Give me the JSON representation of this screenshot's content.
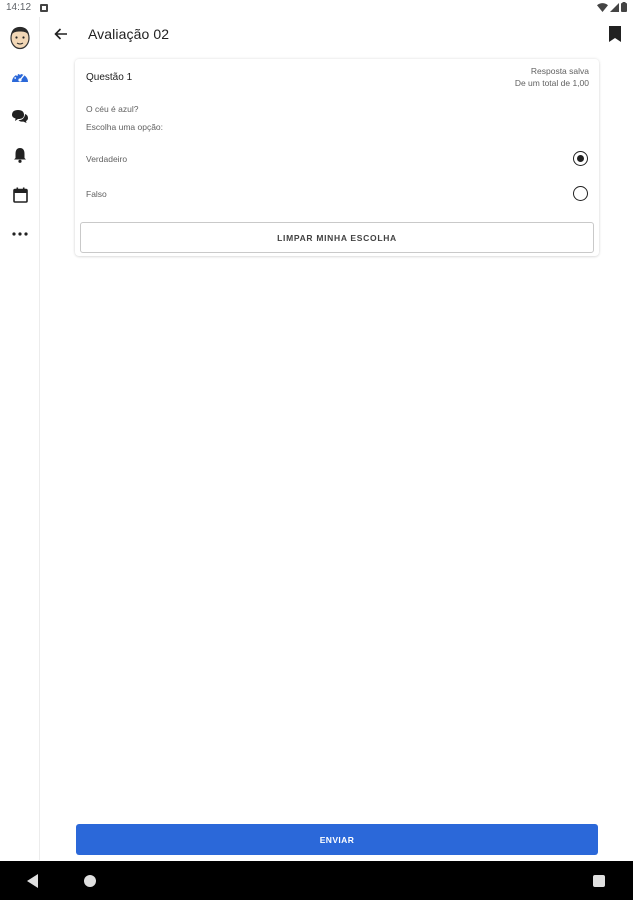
{
  "status_bar": {
    "time": "14:12",
    "icons": [
      "wifi-icon",
      "signal-icon",
      "battery-icon"
    ]
  },
  "sidebar": {
    "items": [
      {
        "name": "avatar",
        "icon": "avatar-icon"
      },
      {
        "name": "dashboard",
        "icon": "dashboard-icon",
        "color": "#2b68d9"
      },
      {
        "name": "messages",
        "icon": "chat-icon"
      },
      {
        "name": "notifications",
        "icon": "bell-icon"
      },
      {
        "name": "calendar",
        "icon": "calendar-icon"
      },
      {
        "name": "more",
        "icon": "more-icon"
      }
    ]
  },
  "header": {
    "title": "Avaliação 02",
    "back_icon": "arrow-back-icon",
    "bookmark_icon": "bookmark-icon"
  },
  "question": {
    "title": "Questão 1",
    "status_line1": "Resposta salva",
    "status_line2": "De um total de 1,00",
    "text": "O céu é azul?",
    "instruction": "Escolha uma opção:",
    "options": [
      {
        "label": "Verdadeiro",
        "selected": true
      },
      {
        "label": "Falso",
        "selected": false
      }
    ],
    "clear_label": "LIMPAR MINHA ESCOLHA"
  },
  "submit": {
    "label": "ENVIAR",
    "color": "#2b68d9"
  },
  "navigation_bar": {
    "icons": [
      "nav-back-icon",
      "nav-home-icon",
      "nav-recents-icon"
    ]
  }
}
